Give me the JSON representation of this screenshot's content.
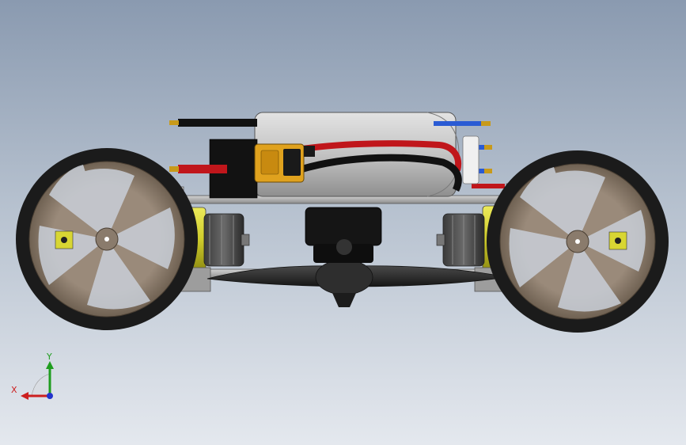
{
  "triad": {
    "x_label": "X",
    "y_label": "Y",
    "x_color": "#cc1f1f",
    "y_color": "#1f9d1f",
    "z_color": "#2233cc"
  },
  "colors": {
    "background_top": "#8a9ab0",
    "background_bottom": "#e4e8ee",
    "tire": "#1b1b1b",
    "rim": "#8a7b6c",
    "motor_bracket": "#d8d633",
    "chassis_plate": "#b8b8b8",
    "battery": "#c3c3c3",
    "connector": "#e0a21e",
    "wire_red": "#c0161b",
    "wire_black": "#111111",
    "wire_blue": "#2a5bd4",
    "propeller": "#2a2a2a"
  },
  "icons": {
    "left_wheel": "wheel-icon",
    "right_wheel": "wheel-icon",
    "battery": "battery-icon",
    "connector": "xt60-connector-icon",
    "motor": "motor-icon",
    "propeller": "propeller-icon"
  }
}
